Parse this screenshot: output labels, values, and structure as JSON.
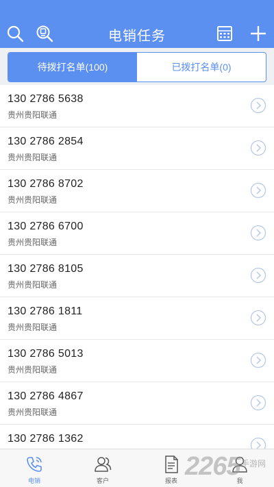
{
  "header": {
    "title": "电销任务",
    "icons": [
      "search-icon",
      "lightbulb-search-icon",
      "calculator-icon",
      "plus-icon"
    ],
    "color": "#5b8ff0"
  },
  "tabs": [
    {
      "label": "待拨打名单(100)",
      "active": true
    },
    {
      "label": "已拨打名单(0)",
      "active": false
    }
  ],
  "list": [
    {
      "phone": "130 2786 5638",
      "carrier": "贵州贵阳联通"
    },
    {
      "phone": "130 2786 2854",
      "carrier": "贵州贵阳联通"
    },
    {
      "phone": "130 2786 8702",
      "carrier": "贵州贵阳联通"
    },
    {
      "phone": "130 2786 6700",
      "carrier": "贵州贵阳联通"
    },
    {
      "phone": "130 2786 8105",
      "carrier": "贵州贵阳联通"
    },
    {
      "phone": "130 2786 1811",
      "carrier": "贵州贵阳联通"
    },
    {
      "phone": "130 2786 5013",
      "carrier": "贵州贵阳联通"
    },
    {
      "phone": "130 2786 4867",
      "carrier": "贵州贵阳联通"
    },
    {
      "phone": "130 2786 1362",
      "carrier": ""
    }
  ],
  "bottom_nav": [
    {
      "label": "电销",
      "icon": "phone-icon",
      "active": true
    },
    {
      "label": "客户",
      "icon": "users-icon",
      "active": false
    },
    {
      "label": "报表",
      "icon": "report-icon",
      "active": false
    },
    {
      "label": "我",
      "icon": "user-icon",
      "active": false
    }
  ],
  "watermark": {
    "number": "2265",
    "site": "手游网"
  }
}
